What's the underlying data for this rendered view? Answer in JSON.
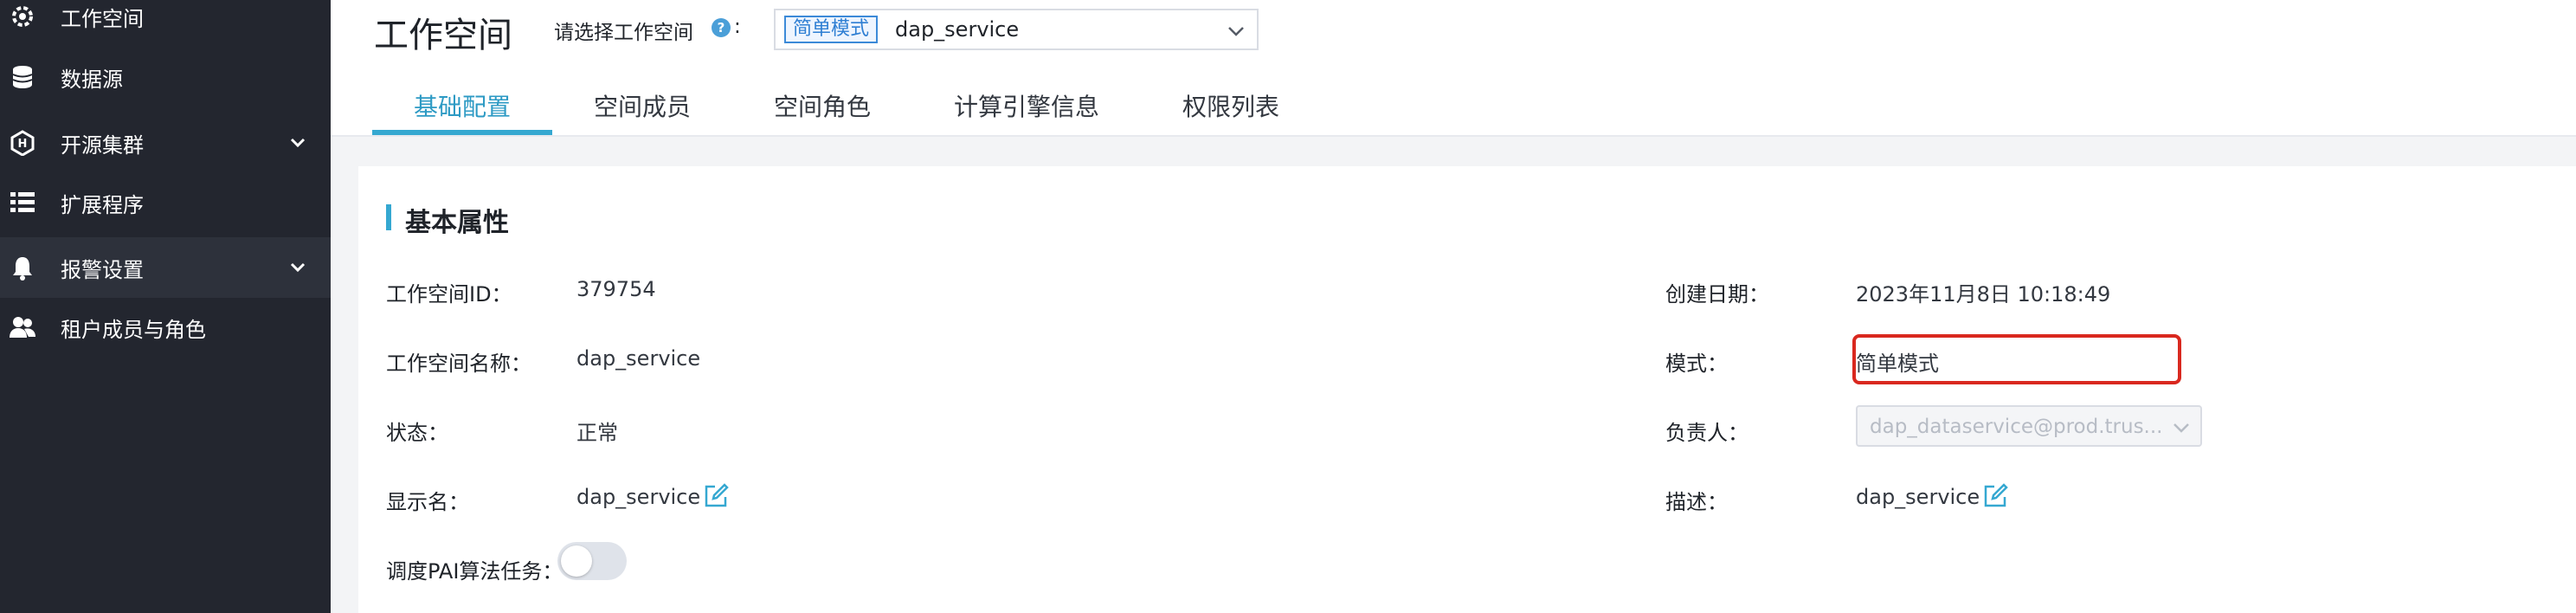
{
  "sidebar": {
    "items": [
      {
        "label": "工作空间",
        "icon": "gear-icon"
      },
      {
        "label": "数据源",
        "icon": "database-icon"
      },
      {
        "label": "开源集群",
        "icon": "cluster-icon"
      },
      {
        "label": "扩展程序",
        "icon": "extension-icon"
      },
      {
        "label": "报警设置",
        "icon": "bell-icon"
      },
      {
        "label": "租户成员与角色",
        "icon": "users-icon"
      }
    ]
  },
  "header": {
    "title": "工作空间",
    "workspace_label": "请选择工作空间",
    "help_glyph": "?",
    "colon": ":",
    "mode_tag": "简单模式",
    "workspace_value": "dap_service"
  },
  "tabs": [
    {
      "label": "基础配置",
      "active": true
    },
    {
      "label": "空间成员",
      "active": false
    },
    {
      "label": "空间角色",
      "active": false
    },
    {
      "label": "计算引擎信息",
      "active": false
    },
    {
      "label": "权限列表",
      "active": false
    }
  ],
  "section": {
    "title": "基本属性"
  },
  "fields": {
    "ws_id_label": "工作空间ID：",
    "ws_id_value": "379754",
    "ws_name_label": "工作空间名称：",
    "ws_name_value": "dap_service",
    "status_label": "状态：",
    "status_value": "正常",
    "display_label": "显示名：",
    "display_value": "dap_service",
    "pai_label": "调度PAI算法任务：",
    "created_label": "创建日期：",
    "created_value": "2023年11月8日 10:18:49",
    "mode_label": "模式：",
    "mode_value": "简单模式",
    "owner_label": "负责人：",
    "owner_value": "dap_dataservice@prod.trus...",
    "desc_label": "描述：",
    "desc_value": "dap_service"
  },
  "colors": {
    "accent": "#35a8d1",
    "highlight": "#d9281f",
    "sidebar_bg": "#23262f"
  }
}
